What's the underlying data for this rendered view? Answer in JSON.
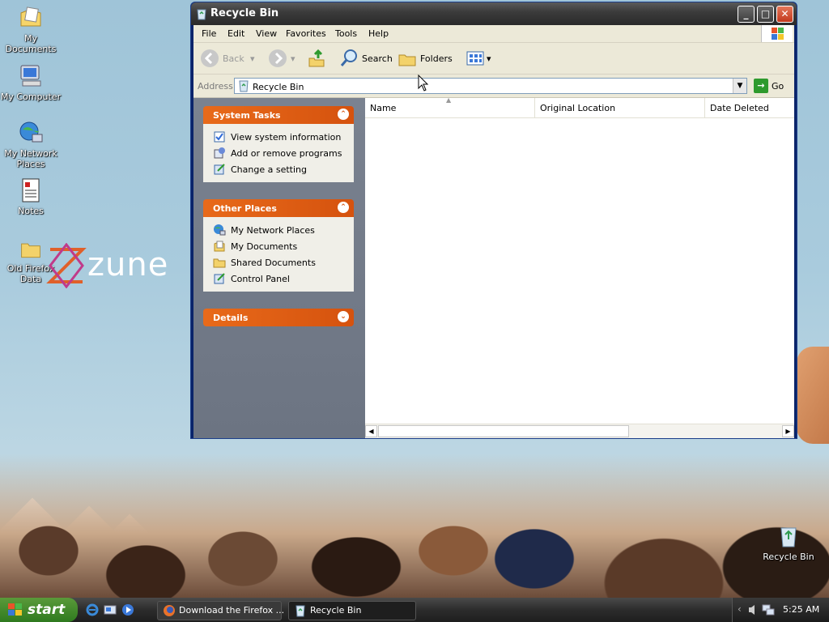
{
  "desktop": {
    "icons": [
      {
        "label": "My Documents",
        "icon": "my-documents-icon"
      },
      {
        "label": "My Computer",
        "icon": "my-computer-icon"
      },
      {
        "label": "My Network Places",
        "icon": "network-places-icon"
      },
      {
        "label": "Notes",
        "icon": "notes-icon"
      },
      {
        "label": "Old Firefox Data",
        "icon": "folder-icon"
      },
      {
        "label": "Recycle Bin",
        "icon": "recycle-bin-icon"
      }
    ],
    "wallpaper_logo": "zune"
  },
  "window": {
    "title": "Recycle Bin",
    "menu": [
      "File",
      "Edit",
      "View",
      "Favorites",
      "Tools",
      "Help"
    ],
    "toolbar": {
      "back": "Back",
      "search": "Search",
      "folders": "Folders"
    },
    "address": {
      "label": "Address",
      "value": "Recycle Bin",
      "go": "Go"
    },
    "task_panels": {
      "system_tasks": {
        "title": "System Tasks",
        "items": [
          "View system information",
          "Add or remove programs",
          "Change a setting"
        ]
      },
      "other_places": {
        "title": "Other Places",
        "items": [
          "My Network Places",
          "My Documents",
          "Shared Documents",
          "Control Panel"
        ]
      },
      "details": {
        "title": "Details"
      }
    },
    "columns": [
      "Name",
      "Original Location",
      "Date Deleted"
    ]
  },
  "taskbar": {
    "start": "start",
    "tasks": [
      {
        "label": "Download the Firefox ...",
        "icon": "firefox-icon"
      },
      {
        "label": "Recycle Bin",
        "icon": "recycle-bin-icon"
      }
    ],
    "clock": "5:25 AM"
  },
  "colors": {
    "panel_header": "#d5520e",
    "task_pane": "#6c7482",
    "start_button": "#2f7a1f"
  }
}
